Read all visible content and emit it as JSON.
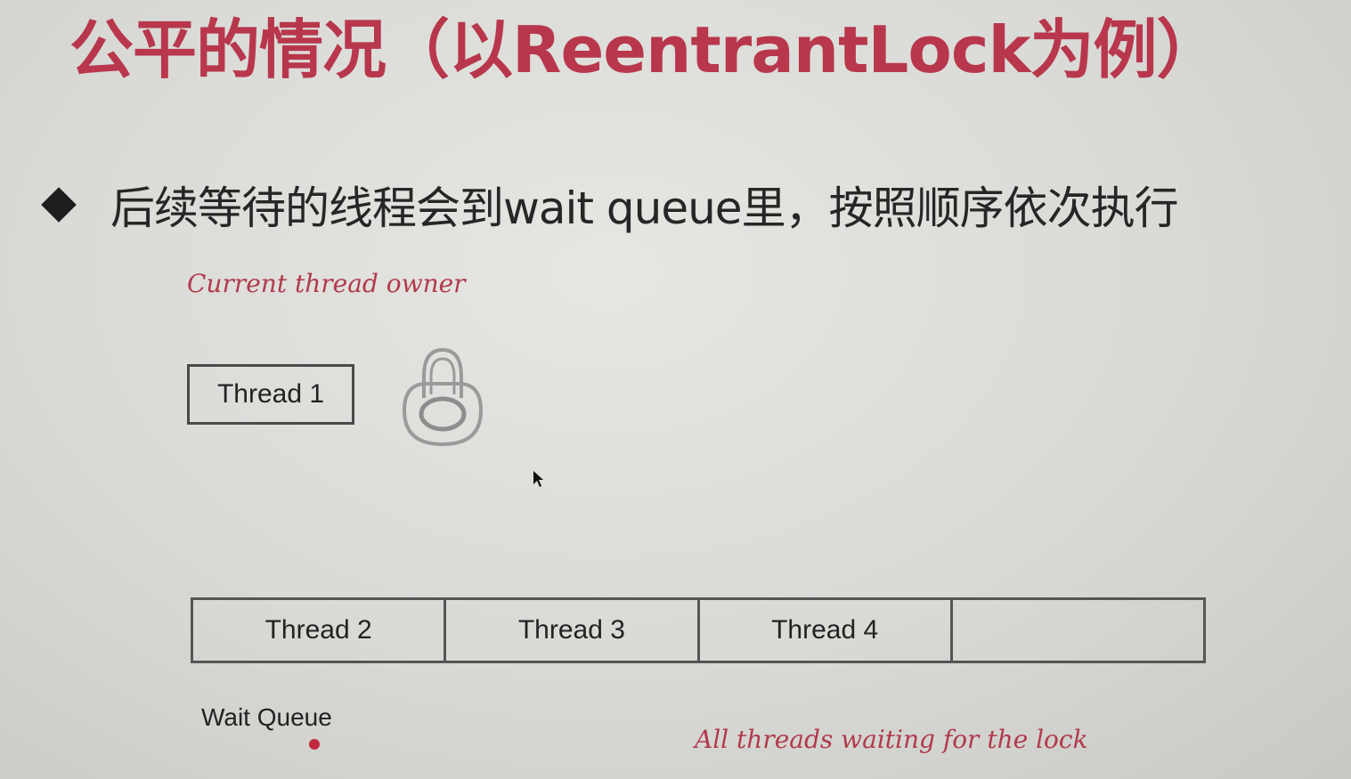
{
  "slide": {
    "title": "公平的情况（以ReentrantLock为例）",
    "bullet": "后续等待的线程会到wait queue里，按照顺序依次执行",
    "owner_label": "Current thread owner",
    "owner_thread": "Thread 1",
    "queue_items": [
      "Thread 2",
      "Thread 3",
      "Thread 4",
      ""
    ],
    "queue_label": "Wait Queue",
    "waiting_label": "All threads waiting for the lock",
    "colors": {
      "title": "#b8374c",
      "annotation": "#b23a4c",
      "dot": "#c0283e"
    },
    "icons": [
      "diamond-bullet-icon",
      "lock-icon",
      "cursor-icon"
    ]
  }
}
